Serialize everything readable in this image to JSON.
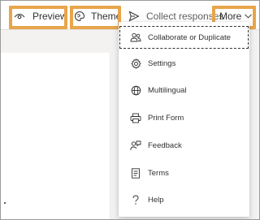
{
  "toolbar": {
    "preview_label": "Preview",
    "theme_label": "Theme",
    "collect_label": "Collect responses",
    "more_label": "More"
  },
  "menu": {
    "items": [
      {
        "label": "Collaborate or Duplicate",
        "icon": "people-icon"
      },
      {
        "label": "Settings",
        "icon": "gear-icon"
      },
      {
        "label": "Multilingual",
        "icon": "globe-icon"
      },
      {
        "label": "Print Form",
        "icon": "printer-icon"
      },
      {
        "label": "Feedback",
        "icon": "feedback-icon"
      },
      {
        "label": "Terms",
        "icon": "document-icon"
      },
      {
        "label": "Help",
        "icon": "question-icon"
      }
    ]
  },
  "colors": {
    "highlight": "#e8a54b",
    "text": "#323130",
    "background": "#f3f2f1"
  }
}
